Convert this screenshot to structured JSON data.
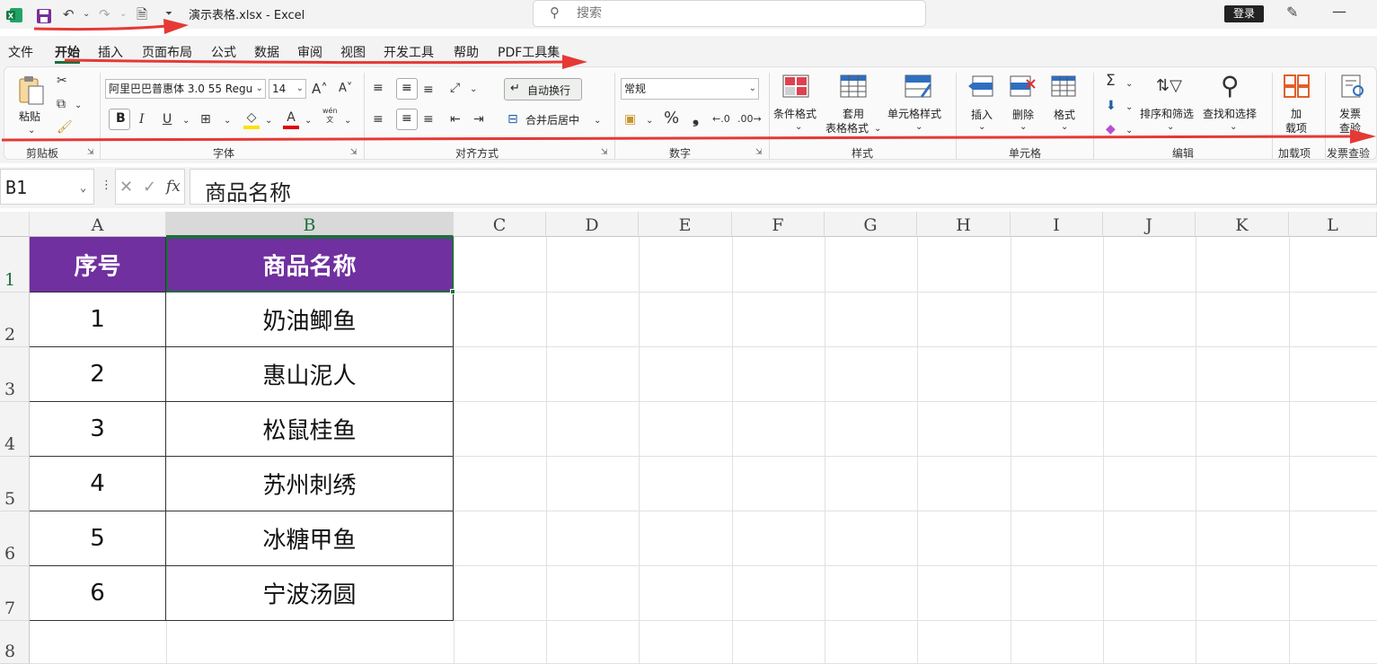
{
  "titlebar": {
    "filename": "演示表格.xlsx  -  Excel",
    "search_placeholder": "搜索",
    "login_label": "登录",
    "minimize_glyph": "—"
  },
  "menu": {
    "tabs": [
      "文件",
      "开始",
      "插入",
      "页面布局",
      "公式",
      "数据",
      "审阅",
      "视图",
      "开发工具",
      "帮助",
      "PDF工具集"
    ],
    "active_tab": "开始"
  },
  "ribbon": {
    "clipboard": {
      "paste_label": "粘贴",
      "group_label": "剪贴板"
    },
    "font": {
      "font_name": "阿里巴巴普惠体 3.0 55 Regu",
      "font_size": "14",
      "bold": "B",
      "italic": "I",
      "underline": "U",
      "phonetic_top": "wén",
      "phonetic_bottom": "文",
      "group_label": "字体"
    },
    "alignment": {
      "wrap_label": "自动换行",
      "merge_label": "合并后居中",
      "group_label": "对齐方式"
    },
    "number": {
      "format": "常规",
      "percent": "%",
      "comma": "❟",
      "group_label": "数字"
    },
    "styles": {
      "conditional_label": "条件格式",
      "table_label_1": "套用",
      "table_label_2": "表格格式",
      "cell_style_label": "单元格样式",
      "group_label": "样式"
    },
    "cells": {
      "insert_label": "插入",
      "delete_label": "删除",
      "format_label": "格式",
      "group_label": "单元格"
    },
    "editing": {
      "sum_glyph": "Σ",
      "sort_label": "排序和筛选",
      "find_label": "查找和选择",
      "group_label": "编辑"
    },
    "addins": {
      "label_1": "加",
      "label_2": "载项",
      "group_label": "加载项"
    },
    "invoice": {
      "label_1": "发票",
      "label_2": "查验",
      "group_label": "发票查验"
    }
  },
  "formula_bar": {
    "name_box": "B1",
    "fx": "fx",
    "content": "商品名称"
  },
  "grid": {
    "columns": [
      "A",
      "B",
      "C",
      "D",
      "E",
      "F",
      "G",
      "H",
      "I",
      "J",
      "K",
      "L"
    ],
    "rows": [
      "1",
      "2",
      "3",
      "4",
      "5",
      "6",
      "7",
      "8"
    ],
    "selected_cell": "B1",
    "table": {
      "headers": [
        "序号",
        "商品名称"
      ],
      "rows": [
        [
          "1",
          "奶油鲫鱼"
        ],
        [
          "2",
          "惠山泥人"
        ],
        [
          "3",
          "松鼠桂鱼"
        ],
        [
          "4",
          "苏州刺绣"
        ],
        [
          "5",
          "冰糖甲鱼"
        ],
        [
          "6",
          "宁波汤圆"
        ]
      ],
      "header_fill": "#7030a0"
    }
  },
  "colors": {
    "accent": "#1e6e3e",
    "annotation_arrow": "#e53935"
  }
}
